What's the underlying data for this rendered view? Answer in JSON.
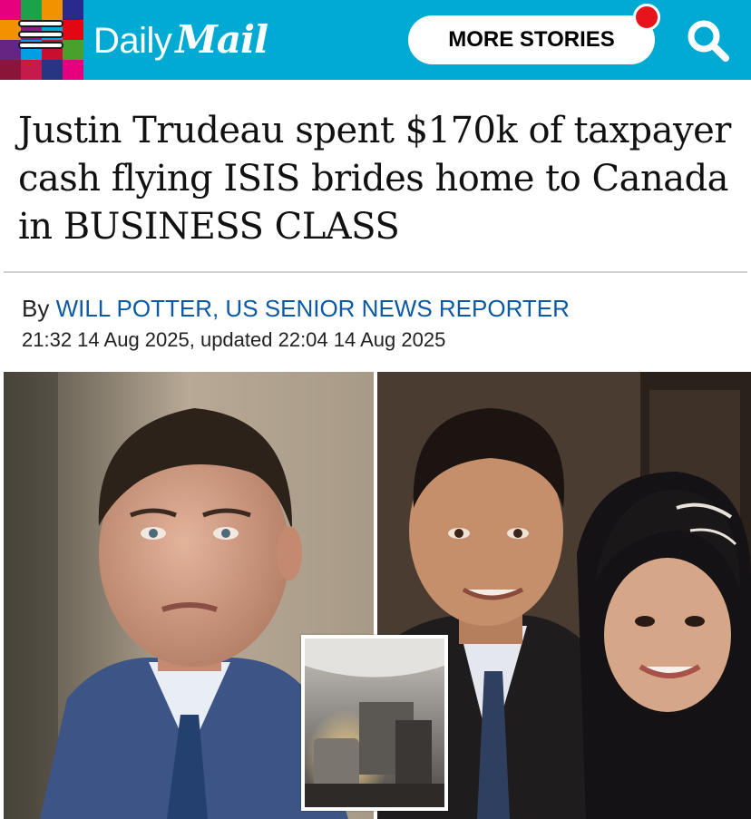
{
  "header": {
    "logo_daily": "Daily",
    "logo_mail": "Mail",
    "more_stories_label": "MORE STORIES",
    "colors": {
      "bar": "#00aad2",
      "notification": "#e8141b"
    },
    "icons": [
      "menu-icon",
      "search-icon"
    ]
  },
  "article": {
    "headline": "Justin Trudeau spent $170k of taxpayer cash flying ISIS brides home to Canada in BUSINESS CLASS",
    "byline_prefix": "By ",
    "author": "WILL POTTER, US SENIOR NEWS REPORTER",
    "timestamp": "21:32 14 Aug 2025, updated 22:04 14 Aug 2025"
  },
  "images": {
    "left": "photo of man in suit and blue tie",
    "right": "photo of man and woman in headscarf",
    "inset": "photo of business class airplane cabin"
  }
}
